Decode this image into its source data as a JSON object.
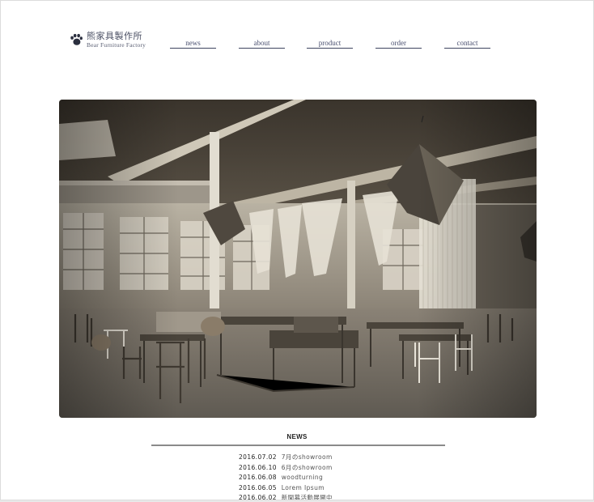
{
  "brand": {
    "name_jp": "熊家具製作所",
    "name_en": "Bear Furniture Factory",
    "logo_icon": "bear-paw-icon"
  },
  "nav": {
    "items": [
      {
        "label": "news"
      },
      {
        "label": "about"
      },
      {
        "label": "product"
      },
      {
        "label": "order"
      },
      {
        "label": "contact"
      }
    ]
  },
  "hero": {
    "description": "sepia photo of an industrial showroom with tables, chairs and hanging fabric lamps"
  },
  "news": {
    "heading": "NEWS",
    "items": [
      {
        "date": "2016.07.02",
        "title": "7月のshowroom"
      },
      {
        "date": "2016.06.10",
        "title": "6月のshowroom"
      },
      {
        "date": "2016.06.08",
        "title": "woodturning"
      },
      {
        "date": "2016.06.05",
        "title": "Lorem Ipsum"
      },
      {
        "date": "2016.06.02",
        "title": "新聞募活動展開中"
      }
    ]
  },
  "colors": {
    "nav_text": "#4a5070",
    "nav_underline": "#3e4460",
    "rule": "#8a8a8a"
  }
}
